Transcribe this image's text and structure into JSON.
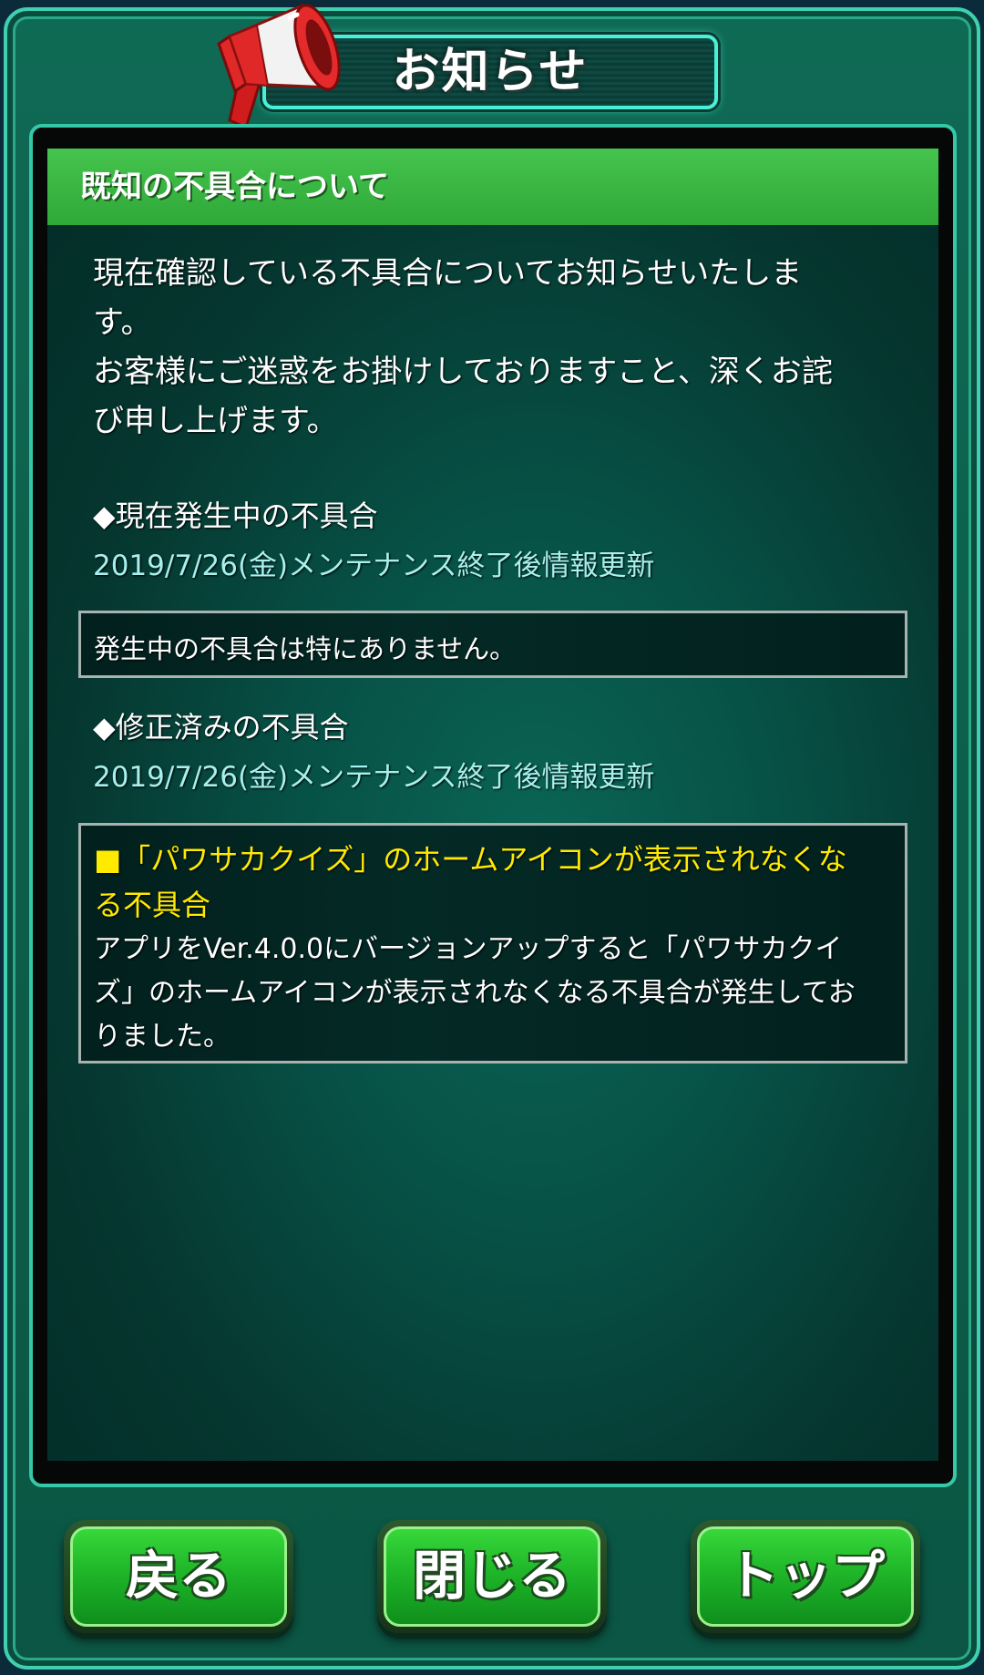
{
  "window": {
    "title": "お知らせ"
  },
  "panel": {
    "header": "既知の不具合について",
    "intro_lines": [
      "現在確認している不具合についてお知らせいたしま",
      "す。",
      "お客様にご迷惑をお掛けしておりますこと、深くお詫",
      "び申し上げます。"
    ]
  },
  "current_issues": {
    "title": "◆現在発生中の不具合",
    "date": "2019/7/26(金)メンテナンス終了後情報更新",
    "box_text": "発生中の不具合は特にありません。"
  },
  "fixed_issues": {
    "title": "◆修正済みの不具合",
    "date": "2019/7/26(金)メンテナンス終了後情報更新",
    "item_title_lines": [
      "■「パワサカクイズ」のホームアイコンが表示されなくな",
      "る不具合"
    ],
    "item_body_lines": [
      "アプリをVer.4.0.0にバージョンアップすると「パワサカクイ",
      "ズ」のホームアイコンが表示されなくなる不具合が発生してお",
      "りました。"
    ]
  },
  "buttons": {
    "back": "戻る",
    "close": "閉じる",
    "top": "トップ"
  },
  "colors": {
    "header_green": "#2fa838",
    "date_cyan": "#a8f0ee",
    "fix_yellow": "#ffea00",
    "button_green": "#1fb629"
  },
  "icons": {
    "megaphone": "megaphone-icon"
  }
}
